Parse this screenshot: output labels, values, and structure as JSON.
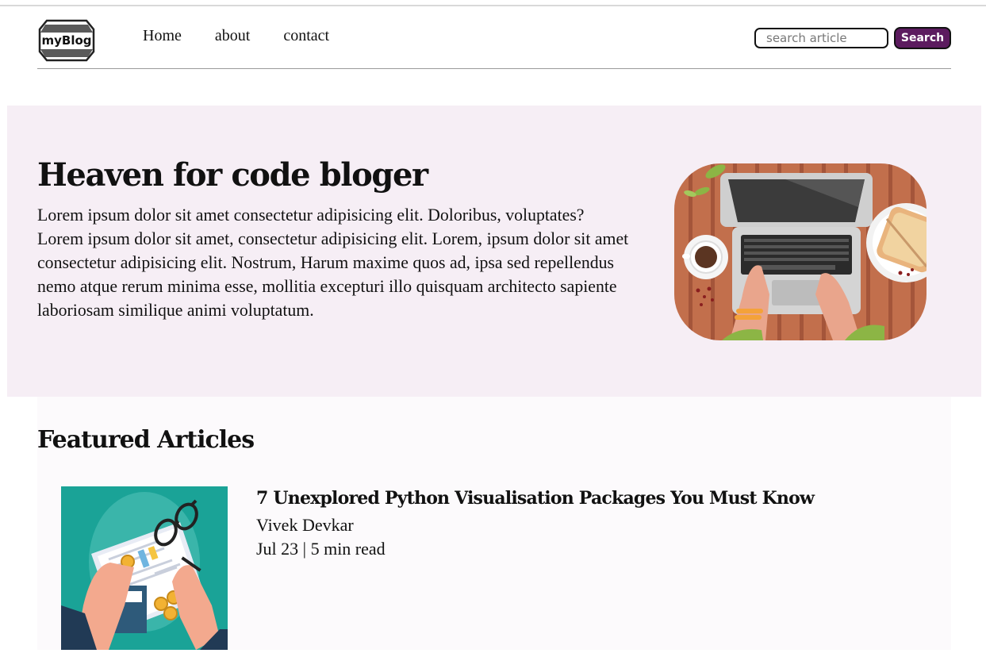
{
  "header": {
    "logo_text": "myBlog",
    "nav": [
      {
        "label": "Home"
      },
      {
        "label": "about"
      },
      {
        "label": "contact"
      }
    ],
    "search": {
      "placeholder": "search article",
      "value": "",
      "button_label": "Search"
    }
  },
  "hero": {
    "title": "Heaven for code bloger",
    "paragraph_1": "Lorem ipsum dolor sit amet consectetur adipisicing elit. Doloribus, voluptates?",
    "paragraph_2": "Lorem ipsum dolor sit amet, consectetur adipisicing elit. Lorem, ipsum dolor sit amet consectetur adipisicing elit. Nostrum, Harum maxime quos ad, ipsa sed repellendus nemo atque rerum minima esse, mollitia excepturi illo quisquam architecto sapiente laboriosam similique animi voluptatum.",
    "image_icon": "laptop-desk-illustration"
  },
  "featured": {
    "heading": "Featured Articles",
    "articles": [
      {
        "title": "7 Unexplored Python Visualisation Packages You Must Know",
        "author": "Vivek Devkar",
        "meta": "Jul 23 | 5 min read",
        "image_icon": "finance-document-illustration"
      }
    ]
  },
  "colors": {
    "accent": "#5c1b5f",
    "hero_bg": "#f6eef5",
    "featured_bg": "#fcfafc",
    "article_img_bg": "#1aa397"
  }
}
